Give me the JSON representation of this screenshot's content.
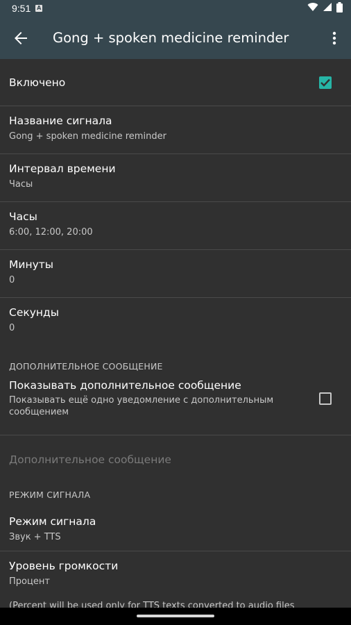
{
  "status_bar": {
    "time": "9:51",
    "notification_icon_letter": "A",
    "icons": [
      "wifi-icon",
      "signal-icon",
      "battery-icon"
    ]
  },
  "app_bar": {
    "title": "Gong + spoken medicine reminder",
    "background": "#36474f"
  },
  "preferences": {
    "enabled": {
      "title": "Включено",
      "checked": true
    },
    "signal_name": {
      "title": "Название сигнала",
      "summary": "Gong + spoken medicine reminder"
    },
    "time_interval": {
      "title": "Интервал времени",
      "summary": "Часы"
    },
    "hours": {
      "title": "Часы",
      "summary": "6:00, 12:00, 20:00"
    },
    "minutes": {
      "title": "Минуты",
      "summary": "0"
    },
    "seconds": {
      "title": "Секунды",
      "summary": "0"
    }
  },
  "extra_message_section": {
    "header": "ДОПОЛНИТЕЛЬНОЕ СООБЩЕНИЕ",
    "show_extra": {
      "title": "Показывать дополнительное сообщение",
      "summary": "Показывать ещё одно уведомление с дополнительным сообщением",
      "checked": false
    },
    "extra_message": {
      "title": "Дополнительное сообщение",
      "enabled": false
    }
  },
  "signal_mode_section": {
    "header": "РЕЖИМ СИГНАЛА",
    "signal_mode": {
      "title": "Режим сигнала",
      "summary": "Звук + TTS"
    },
    "volume_level": {
      "title": "Уровень громкости",
      "summary": "Процент"
    },
    "cut_off_text": "(Percent will be used only for TTS texts converted to audio files"
  },
  "colors": {
    "accent": "#26b5a6",
    "background": "#303030"
  }
}
